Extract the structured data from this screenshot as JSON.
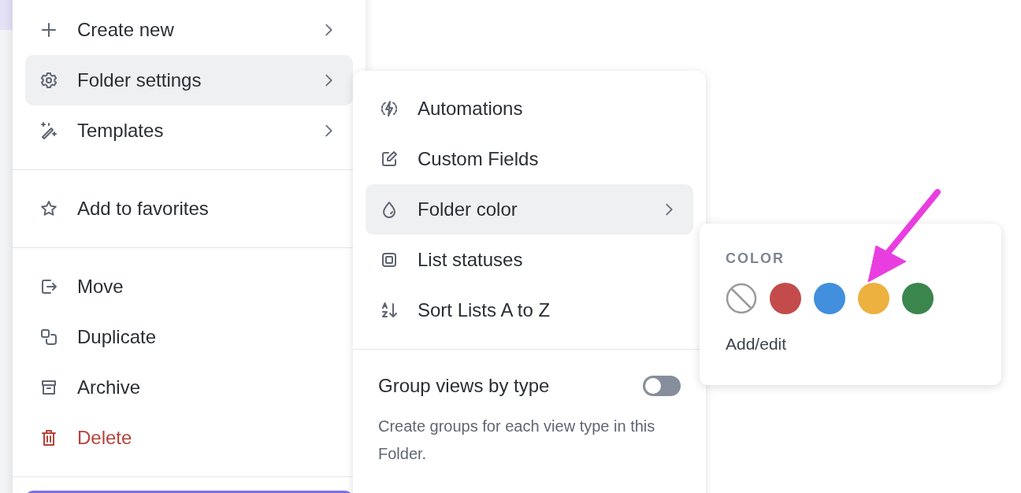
{
  "main_menu": {
    "groups": [
      [
        {
          "label": "Create new",
          "kind": "normal",
          "submenu": true,
          "selected": false
        },
        {
          "label": "Folder settings",
          "kind": "normal",
          "submenu": true,
          "selected": true
        },
        {
          "label": "Templates",
          "kind": "normal",
          "submenu": true,
          "selected": false
        }
      ],
      [
        {
          "label": "Add to favorites",
          "kind": "normal",
          "submenu": false,
          "selected": false
        }
      ],
      [
        {
          "label": "Move",
          "kind": "normal",
          "submenu": false,
          "selected": false
        },
        {
          "label": "Duplicate",
          "kind": "normal",
          "submenu": false,
          "selected": false
        },
        {
          "label": "Archive",
          "kind": "normal",
          "submenu": false,
          "selected": false
        },
        {
          "label": "Delete",
          "kind": "danger",
          "submenu": false,
          "selected": false
        }
      ]
    ]
  },
  "settings_menu": {
    "items": [
      {
        "label": "Automations",
        "submenu": false,
        "selected": false
      },
      {
        "label": "Custom Fields",
        "submenu": false,
        "selected": false
      },
      {
        "label": "Folder color",
        "submenu": true,
        "selected": true
      },
      {
        "label": "List statuses",
        "submenu": false,
        "selected": false
      },
      {
        "label": "Sort Lists A to Z",
        "submenu": false,
        "selected": false
      }
    ],
    "toggle": {
      "label": "Group views by type",
      "on": false,
      "description": "Create groups for each view type in this Folder."
    }
  },
  "color_popover": {
    "heading": "COLOR",
    "swatches": [
      {
        "kind": "none"
      },
      {
        "kind": "color",
        "color": "#c44b4b"
      },
      {
        "kind": "color",
        "color": "#418fdd"
      },
      {
        "kind": "color",
        "color": "#edb13f"
      },
      {
        "kind": "color",
        "color": "#3a864d"
      }
    ],
    "link": "Add/edit"
  }
}
